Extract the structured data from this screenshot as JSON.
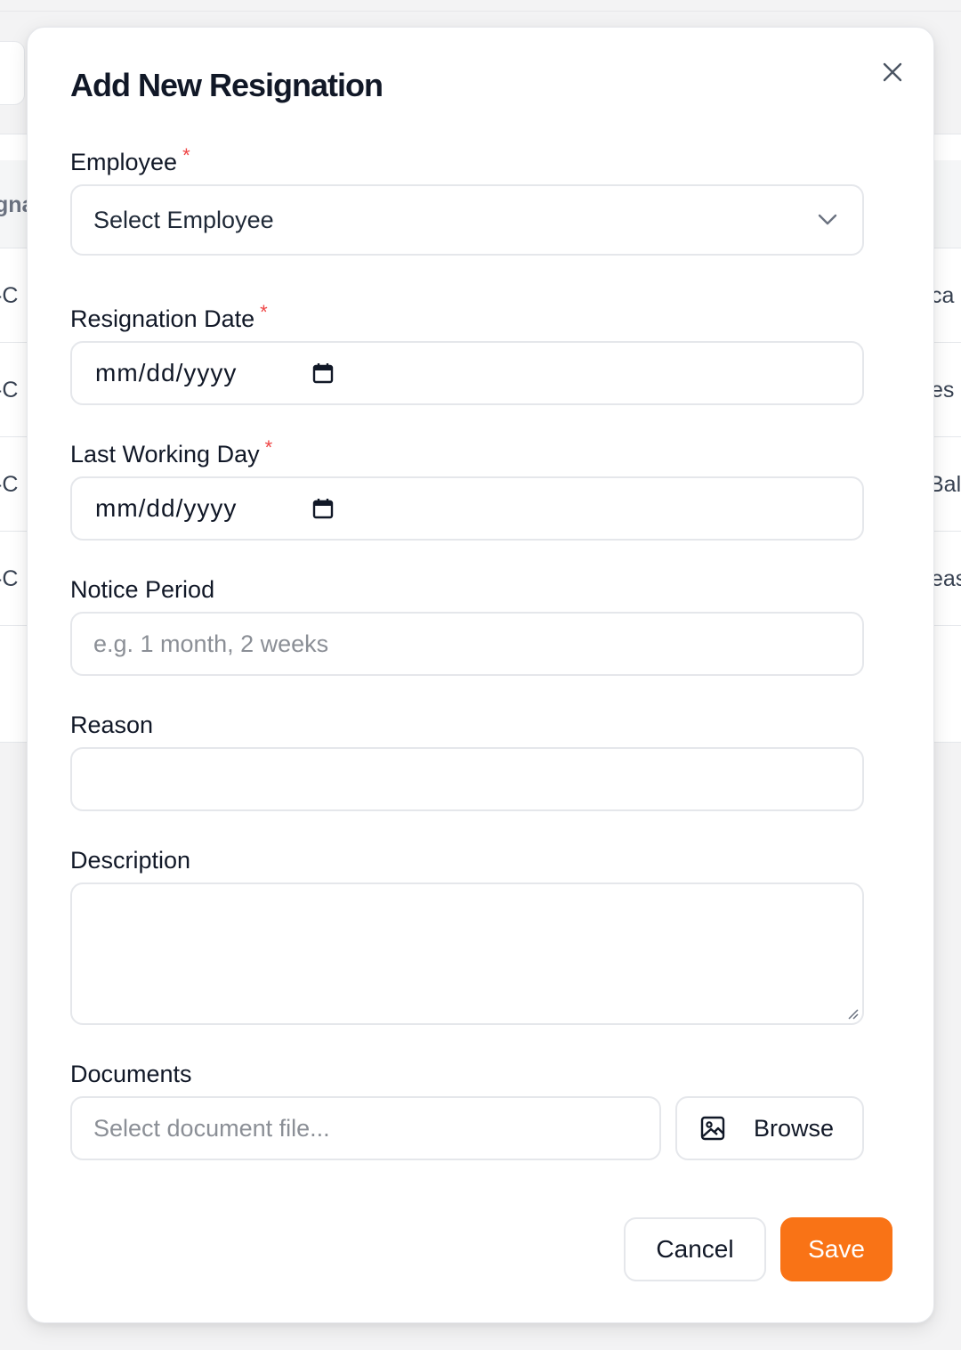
{
  "background": {
    "header_fragment": "gna",
    "rows_left": [
      "-C",
      "-C",
      "-C",
      "-C"
    ],
    "rows_right": [
      "ca",
      "es",
      "Bal",
      "eas"
    ]
  },
  "modal": {
    "title": "Add New Resignation",
    "close_icon": "close-icon",
    "fields": {
      "employee": {
        "label": "Employee",
        "required_mark": "*",
        "selected": "Select Employee",
        "icon": "chevron-down-icon"
      },
      "resignation_date": {
        "label": "Resignation Date",
        "required_mark": "*",
        "value": "mm/dd/yyyy",
        "icon": "calendar-icon"
      },
      "last_working_day": {
        "label": "Last Working Day",
        "required_mark": "*",
        "value": "mm/dd/yyyy",
        "icon": "calendar-icon"
      },
      "notice_period": {
        "label": "Notice Period",
        "value": "",
        "placeholder": "e.g. 1 month, 2 weeks"
      },
      "reason": {
        "label": "Reason",
        "value": ""
      },
      "description": {
        "label": "Description",
        "value": ""
      },
      "documents": {
        "label": "Documents",
        "placeholder": "Select document file...",
        "browse_label": "Browse",
        "browse_icon": "image-icon"
      }
    },
    "actions": {
      "cancel_label": "Cancel",
      "save_label": "Save"
    }
  },
  "colors": {
    "accent": "#f97316",
    "required": "#ef4444",
    "border": "#e5e7eb"
  }
}
